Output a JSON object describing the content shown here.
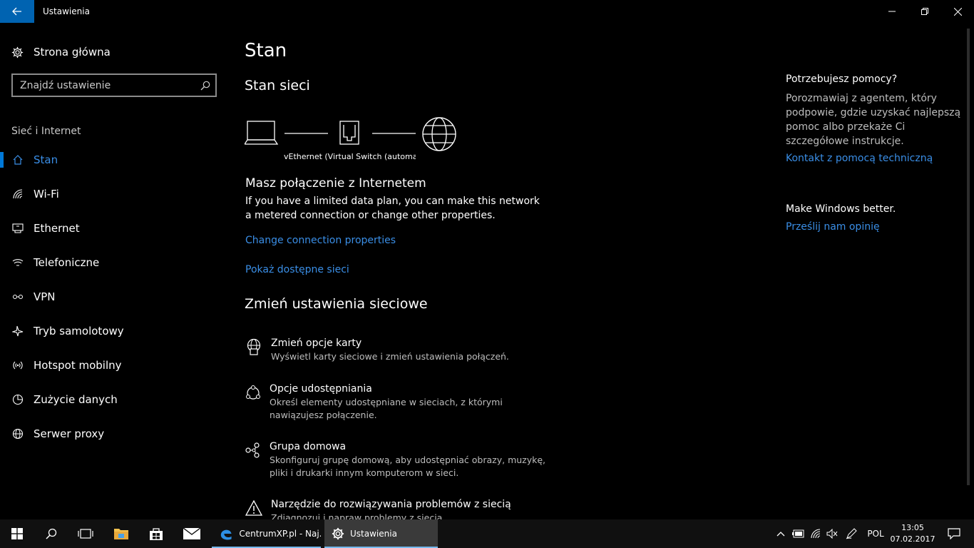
{
  "window": {
    "title": "Ustawienia"
  },
  "sidebar": {
    "home_label": "Strona główna",
    "search_placeholder": "Znajdź ustawienie",
    "category": "Sieć i Internet",
    "items": [
      {
        "label": "Stan",
        "icon": "home-status-icon",
        "active": true
      },
      {
        "label": "Wi-Fi",
        "icon": "wifi-icon",
        "active": false
      },
      {
        "label": "Ethernet",
        "icon": "ethernet-icon",
        "active": false
      },
      {
        "label": "Telefoniczne",
        "icon": "dialup-icon",
        "active": false
      },
      {
        "label": "VPN",
        "icon": "vpn-icon",
        "active": false
      },
      {
        "label": "Tryb samolotowy",
        "icon": "airplane-icon",
        "active": false
      },
      {
        "label": "Hotspot mobilny",
        "icon": "hotspot-icon",
        "active": false
      },
      {
        "label": "Zużycie danych",
        "icon": "data-usage-icon",
        "active": false
      },
      {
        "label": "Serwer proxy",
        "icon": "globe-icon",
        "active": false
      }
    ]
  },
  "main": {
    "page_title": "Stan",
    "section_title": "Stan sieci",
    "adapter_label": "vEthernet (Virtual Switch (automatic",
    "connection_title": "Masz połączenie z Internetem",
    "connection_desc": "If you have a limited data plan, you can make this network a metered connection or change other properties.",
    "link_change_props": "Change connection properties",
    "link_show_networks": "Pokaż dostępne sieci",
    "change_settings_title": "Zmień ustawienia sieciowe",
    "options": [
      {
        "title": "Zmień opcje karty",
        "desc": "Wyświetl karty sieciowe i zmień ustawienia połączeń.",
        "icon": "adapter-options-icon"
      },
      {
        "title": "Opcje udostępniania",
        "desc": "Określ elementy udostępniane w sieciach, z którymi nawiązujesz połączenie.",
        "icon": "sharing-icon"
      },
      {
        "title": "Grupa domowa",
        "desc": "Skonfiguruj grupę domową, aby udostępniać obrazy, muzykę, pliki i drukarki innym komputerom w sieci.",
        "icon": "homegroup-icon"
      },
      {
        "title": "Narzędzie do rozwiązywania problemów z siecią",
        "desc": "Zdiagnozuj i napraw problemy z siecią.",
        "icon": "warning-icon"
      }
    ]
  },
  "help": {
    "heading": "Potrzebujesz pomocy?",
    "text": "Porozmawiaj z agentem, który podpowie, gdzie uzyskać najlepszą pomoc albo przekaże Ci szczegółowe instrukcje.",
    "link": "Kontakt z pomocą techniczną",
    "better_heading": "Make Windows better.",
    "better_link": "Prześlij nam opinię"
  },
  "taskbar": {
    "apps": [
      {
        "label": "CentrumXP.pl - Naj...",
        "icon": "edge-icon"
      },
      {
        "label": "Ustawienia",
        "icon": "settings-gear-icon"
      }
    ],
    "language": "POL",
    "time": "13:05",
    "date": "07.02.2017"
  },
  "colors": {
    "accent": "#0078d7",
    "link": "#3a8ee6",
    "background": "#000000",
    "taskbar": "#101010"
  }
}
